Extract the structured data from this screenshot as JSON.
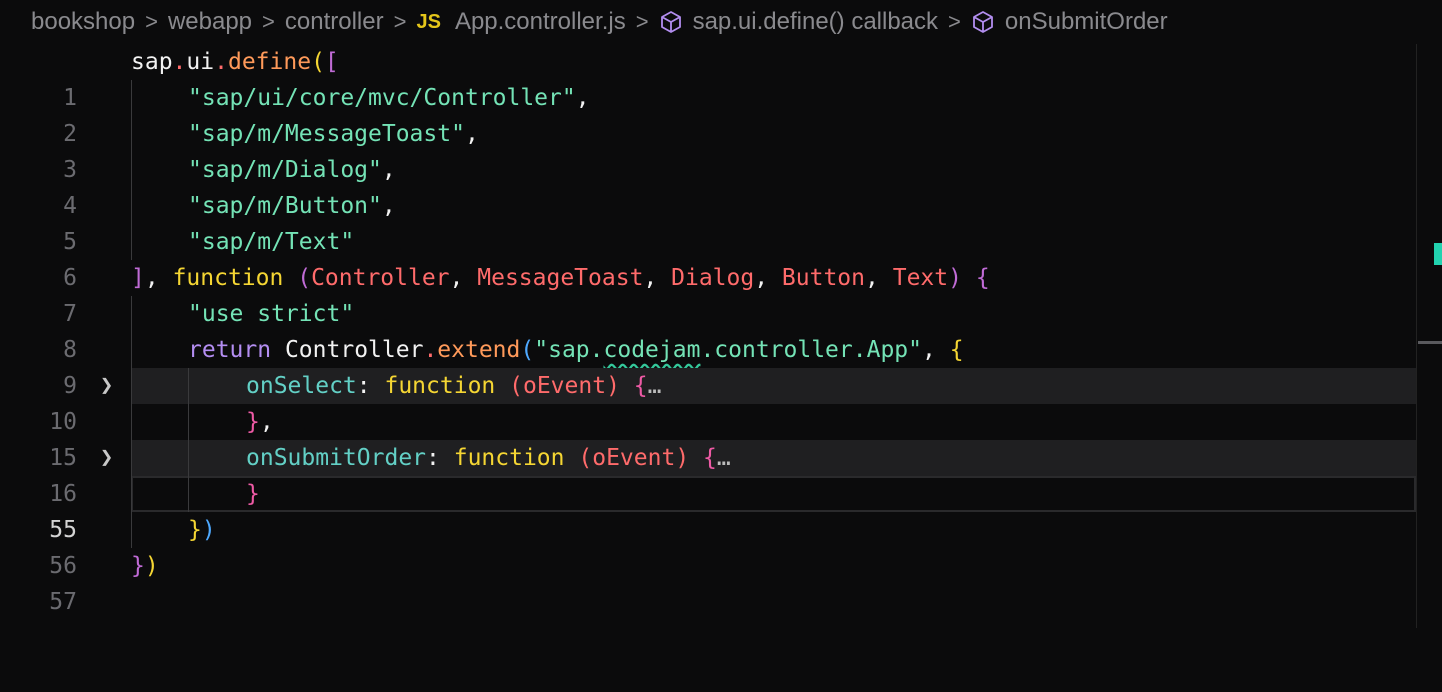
{
  "breadcrumb": {
    "items": [
      "bookshop",
      "webapp",
      "controller",
      "App.controller.js",
      "sap.ui.define() callback",
      "onSubmitOrder"
    ],
    "file_badge": "JS",
    "separator": ">"
  },
  "editor": {
    "line_numbers": [
      "1",
      "2",
      "3",
      "4",
      "5",
      "6",
      "7",
      "8",
      "9",
      "10",
      "15",
      "16",
      "55",
      "56",
      "57"
    ],
    "current_line": "55",
    "folded_lines": [
      "10",
      "16"
    ],
    "fold_indicator": "…",
    "code": {
      "l1": {
        "a": "sap",
        "b": ".",
        "c": "ui",
        "d": ".",
        "e": "define",
        "f": "(",
        "g": "["
      },
      "l2": {
        "s": "\"sap/ui/core/mvc/Controller\"",
        "c": ","
      },
      "l3": {
        "s": "\"sap/m/MessageToast\"",
        "c": ","
      },
      "l4": {
        "s": "\"sap/m/Dialog\"",
        "c": ","
      },
      "l5": {
        "s": "\"sap/m/Button\"",
        "c": ","
      },
      "l6": {
        "s": "\"sap/m/Text\""
      },
      "l7": {
        "a": "]",
        "b": ", ",
        "kw": "function",
        "sp": " ",
        "po": "(",
        "p1": "Controller",
        "c1": ", ",
        "p2": "MessageToast",
        "c2": ", ",
        "p3": "Dialog",
        "c3": ", ",
        "p4": "Button",
        "c4": ", ",
        "p5": "Text",
        "pc": ")",
        "sp2": " ",
        "br": "{"
      },
      "l8": {
        "s": "\"use strict\""
      },
      "l9": {
        "ret": "return",
        "sp": " ",
        "obj": "Controller",
        "dot": ".",
        "fn": "extend",
        "po": "(",
        "s1": "\"sap.",
        "s2": "codejam",
        "s3": ".controller.App\"",
        "c": ", ",
        "br": "{"
      },
      "l10": {
        "prop": "onSelect",
        "col": ": ",
        "kw": "function",
        "sp": " ",
        "po": "(",
        "p": "oEvent",
        "pc": ")",
        "sp2": " ",
        "br": "{"
      },
      "l15": {
        "br": "}",
        "c": ","
      },
      "l16": {
        "prop": "onSubmitOrder",
        "col": ": ",
        "kw": "function",
        "sp": " ",
        "po": "(",
        "p": "oEvent",
        "pc": ")",
        "sp2": " ",
        "br": "{"
      },
      "l55": {
        "br": "}"
      },
      "l56": {
        "a": "}",
        "b": ")"
      },
      "l57": {
        "a": "}",
        "b": ")"
      }
    }
  },
  "colors": {
    "background": "#0b0b0c",
    "string": "#74e3b6",
    "keyword": "#f5d633",
    "parameter": "#ff6b6b",
    "accent_marker": "#22d3b0"
  }
}
